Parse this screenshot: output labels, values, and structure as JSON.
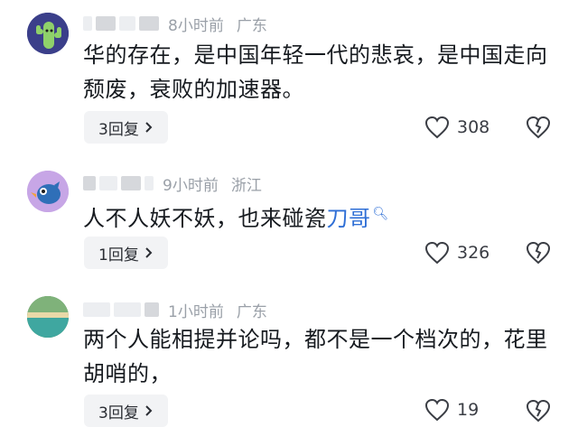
{
  "comments": [
    {
      "time": "8小时前",
      "location": "广东",
      "text": "华的存在，是中国年轻一代的悲哀，是中国走向颓废，衰败的加速器。",
      "text_link": "",
      "reply_label": "3回复",
      "likes": "308",
      "avatar_color": "#3b3f8a"
    },
    {
      "time": "9小时前",
      "location": "浙江",
      "text": "人不人妖不妖，也来碰瓷",
      "text_link": "刀哥",
      "reply_label": "1回复",
      "likes": "326",
      "avatar_color": "#c7a6e6"
    },
    {
      "time": "1小时前",
      "location": "广东",
      "text": "两个人能相提并论吗，都不是一个档次的，花里胡哨的，",
      "text_link": "",
      "reply_label": "3回复",
      "likes": "19",
      "avatar_color": "#4f8c5a"
    }
  ]
}
